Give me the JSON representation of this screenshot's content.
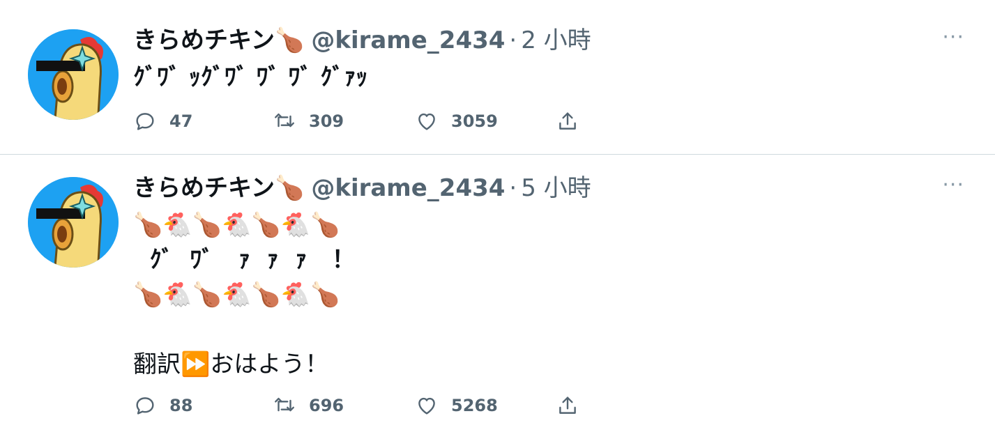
{
  "tweets": [
    {
      "name": "きらめチキン🍗",
      "handle": "@kirame_2434",
      "separator": "·",
      "time": "2 小時",
      "text_lines": [
        "ｸﾞﾜﾞ ｯｸﾞﾜﾞ ﾜﾞ ﾜﾞ ｸﾞｧｯ"
      ],
      "more": "···",
      "replies": "47",
      "retweets": "309",
      "likes": "3059"
    },
    {
      "name": "きらめチキン🍗",
      "handle": "@kirame_2434",
      "separator": "·",
      "time": "5 小時",
      "text_lines": [
        "🍗🐔🍗🐔🍗🐔🍗",
        "  ｸﾞ  ﾜﾞ   ｧ  ｧ  ｧ   ！",
        "🍗🐔🍗🐔🍗🐔🍗",
        "",
        "翻訳⏩おはよう！"
      ],
      "more": "···",
      "replies": "88",
      "retweets": "696",
      "likes": "5268"
    }
  ],
  "colors": {
    "avatar_bg": "#1da1f2",
    "muted": "#536471",
    "divider": "#cfd9de"
  },
  "icons": [
    "reply-icon",
    "retweet-icon",
    "like-icon",
    "share-icon",
    "more-icon"
  ]
}
